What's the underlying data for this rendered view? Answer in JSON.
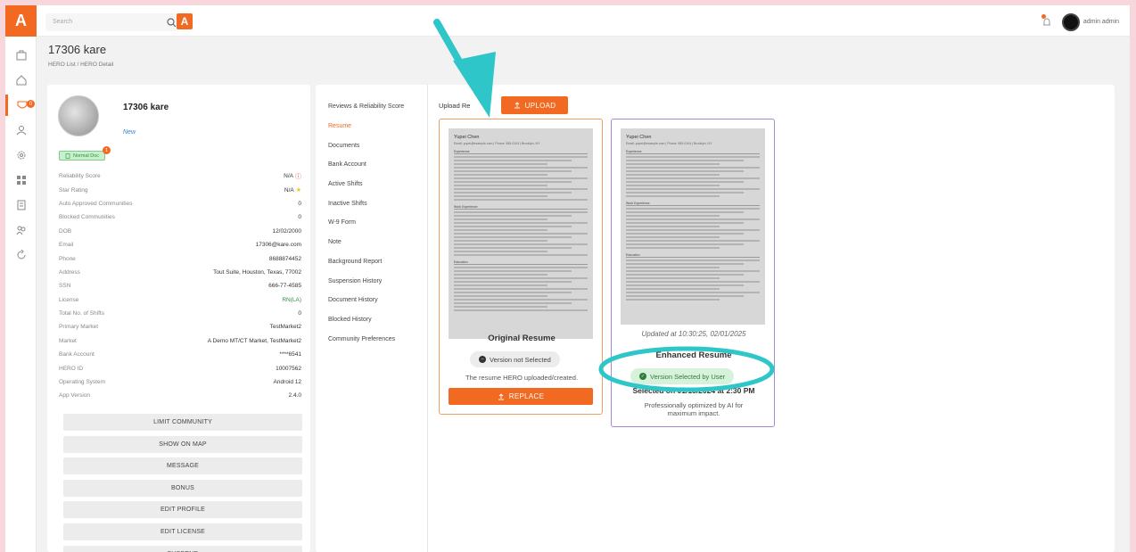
{
  "topbar": {
    "search_placeholder": "Search",
    "user_name": "admin admin",
    "brand_mark": "A"
  },
  "rail": {
    "logo": "A",
    "badge": "0"
  },
  "header": {
    "title": "17306 kare",
    "breadcrumb": "HERO List / HERO Detail"
  },
  "profile": {
    "name": "17306 kare",
    "status": "New",
    "doc_badge": "Normal Doc",
    "doc_count": "1",
    "fields": [
      {
        "key": "Reliability Score",
        "value": "N/A"
      },
      {
        "key": "Star Rating",
        "value": "N/A"
      },
      {
        "key": "Auto Approved Communities",
        "value": "0"
      },
      {
        "key": "Blocked Communities",
        "value": "0"
      },
      {
        "key": "DOB",
        "value": "12/02/2000"
      },
      {
        "key": "Email",
        "value": "17306@kare.com"
      },
      {
        "key": "Phone",
        "value": "8688874452"
      },
      {
        "key": "Address",
        "value": "Tout Suite, Houston, Texas, 77002"
      },
      {
        "key": "SSN",
        "value": "666-77-4585"
      },
      {
        "key": "License",
        "value": "RN(LA)"
      },
      {
        "key": "Total No. of Shifts",
        "value": "0"
      },
      {
        "key": "Primary Market",
        "value": "TestMarket2"
      },
      {
        "key": "Market",
        "value": "A Demo MT/CT Market, TestMarket2"
      },
      {
        "key": "Bank Account",
        "value": "****6541"
      },
      {
        "key": "HERO ID",
        "value": "10007562"
      },
      {
        "key": "Operating System",
        "value": "Android 12"
      },
      {
        "key": "App Version",
        "value": "2.4.0"
      }
    ],
    "buttons": [
      "LIMIT COMMUNITY",
      "SHOW ON MAP",
      "MESSAGE",
      "BONUS",
      "EDIT PROFILE",
      "EDIT LICENSE",
      "SUSPEND"
    ]
  },
  "detail": {
    "menu": [
      "Reviews & Reliability Score",
      "Resume",
      "Documents",
      "Bank Account",
      "Active Shifts",
      "Inactive Shifts",
      "W-9 Form",
      "Note",
      "Background Report",
      "Suspension History",
      "Document History",
      "Blocked History",
      "Community Preferences"
    ],
    "active_menu": "Resume",
    "upload_label": "Upload Re",
    "upload_button": "UPLOAD",
    "original": {
      "title": "Original Resume",
      "version_status": "Version not Selected",
      "description": "The resume HERO uploaded/created.",
      "replace_button": "REPLACE"
    },
    "enhanced": {
      "updated": "Updated at 10:30:25, 02/01/2025",
      "title": "Enhanced Resume",
      "version_status": "Version Selected by User",
      "selected_on": "Selected on 01/15/2024 at 2:30 PM",
      "description": "Professionally optimized by AI for maximum impact."
    },
    "resume_preview": {
      "name": "Yupei Chen",
      "contact": "Email: yupei@example.com | Phone: 555-0104 | Brooklyn, NY",
      "sections": [
        "Experience",
        "Work Experience",
        "Education"
      ]
    }
  },
  "colors": {
    "accent": "#f26a21",
    "enhanced_border": "#a689d2",
    "annotation": "#2ec6c8",
    "selected_green": "#2e7d3a"
  }
}
